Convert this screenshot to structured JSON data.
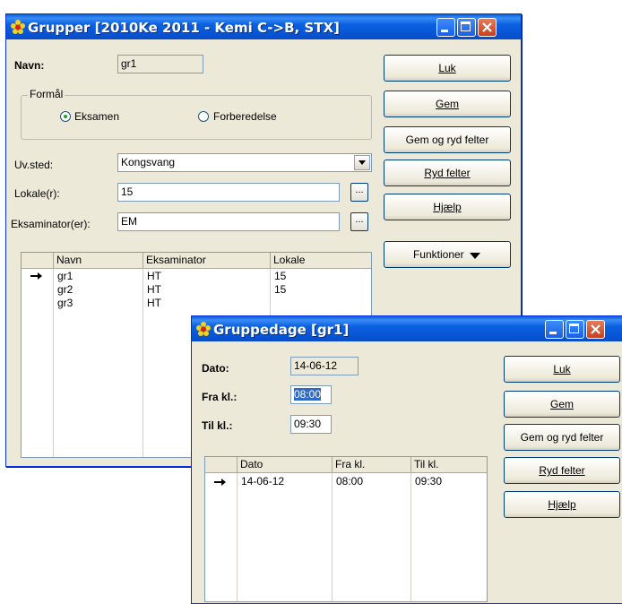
{
  "win1": {
    "title": "Grupper [2010Ke 2011 - Kemi C->B, STX]",
    "navn_label": "Navn:",
    "navn_value": "gr1",
    "formaal_label": "Formål",
    "radio_eksamen": "Eksamen",
    "radio_forberedelse": "Forberedelse",
    "uvsted_label": "Uv.sted:",
    "uvsted_value": "Kongsvang",
    "lokale_label": "Lokale(r):",
    "lokale_value": "15",
    "eksaminator_label": "Eksaminator(er):",
    "eksaminator_value": "EM",
    "buttons": {
      "luk": "Luk",
      "gem": "Gem",
      "gem_ryd": "Gem og ryd felter",
      "ryd": "Ryd felter",
      "hjaelp": "Hjælp",
      "funktioner": "Funktioner"
    },
    "table": {
      "headers": [
        "Navn",
        "Eksaminator",
        "Lokale"
      ],
      "rows": [
        [
          "gr1",
          "HT",
          "15"
        ],
        [
          "gr2",
          "HT",
          "15"
        ],
        [
          "gr3",
          "HT",
          ""
        ]
      ]
    }
  },
  "win2": {
    "title": "Gruppedage [gr1]",
    "dato_label": "Dato:",
    "dato_value": "14-06-12",
    "fra_label": "Fra kl.:",
    "fra_value": "08:00",
    "til_label": "Til kl.:",
    "til_value": "09:30",
    "buttons": {
      "luk": "Luk",
      "gem": "Gem",
      "gem_ryd": "Gem og ryd felter",
      "ryd": "Ryd felter",
      "hjaelp": "Hjælp"
    },
    "table": {
      "headers": [
        "Dato",
        "Fra kl.",
        "Til kl."
      ],
      "rows": [
        [
          "14-06-12",
          "08:00",
          "09:30"
        ]
      ]
    }
  },
  "colors": {
    "titlebar": "#0a5fd8",
    "window_bg": "#ece9d8",
    "selection": "#316ac5"
  },
  "icons": {
    "app": "flower-icon",
    "row_pointer": "arrow-right-icon"
  }
}
